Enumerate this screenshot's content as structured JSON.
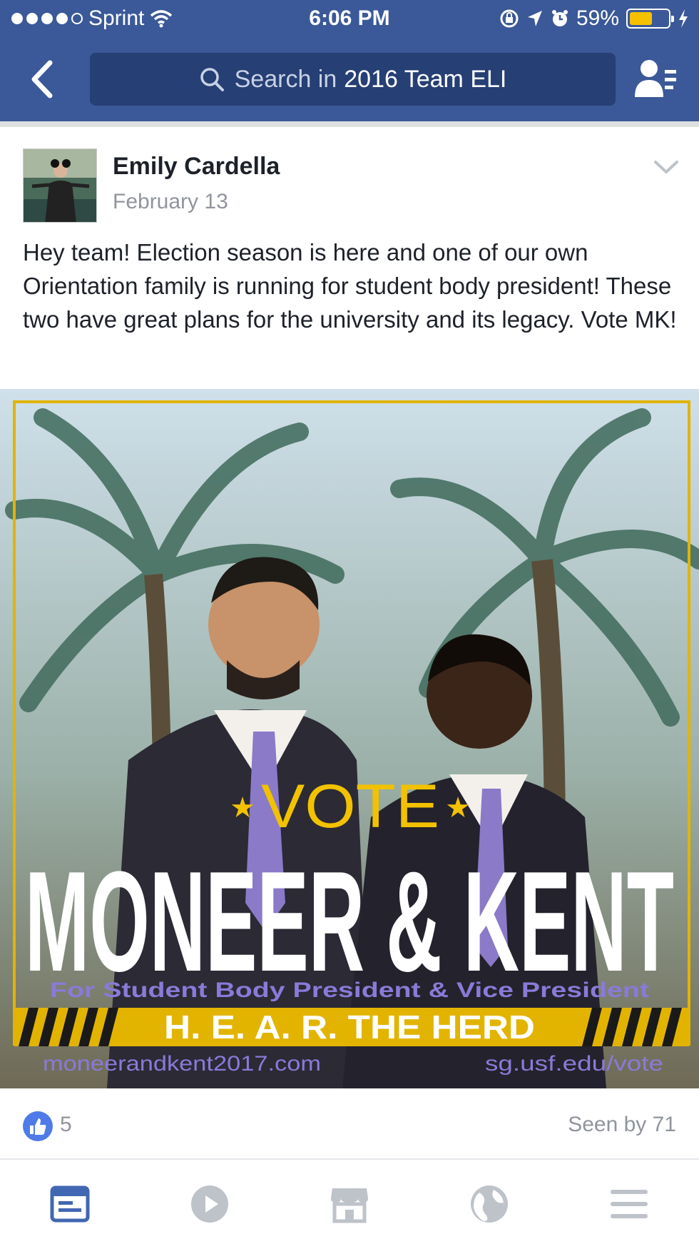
{
  "status_bar": {
    "carrier": "Sprint",
    "time": "6:06 PM",
    "battery": "59%"
  },
  "search": {
    "prefix": "Search in",
    "group_name": "2016 Team ELI"
  },
  "post": {
    "author": "Emily Cardella",
    "date": "February 13",
    "text": "Hey team! Election season is here and one of our own Orientation family is running for student body president! These two have great plans for the university and its legacy. Vote MK!"
  },
  "poster": {
    "vote": "VOTE",
    "names": "MONEER & KENT",
    "subtitle": "For Student Body President & Vice President",
    "slogan": "H. E. A. R. THE HERD",
    "url_left": "moneerandkent2017.com",
    "url_right": "sg.usf.edu/vote"
  },
  "reactions": {
    "likes": "5",
    "seen_by": "Seen by 71"
  },
  "icons": {
    "back": "chevron-left-icon",
    "search": "search-icon",
    "members": "members-icon",
    "options": "chevron-down-icon",
    "like": "thumbs-up-icon",
    "tabs": [
      "news-feed-icon",
      "video-icon",
      "marketplace-icon",
      "globe-icon",
      "menu-icon"
    ]
  },
  "colors": {
    "brand": "#3b5998",
    "search_bg": "#263f74",
    "accent_yellow": "#f2c200",
    "active_tab": "#4267b2",
    "inactive_tab": "#bec2c9"
  }
}
